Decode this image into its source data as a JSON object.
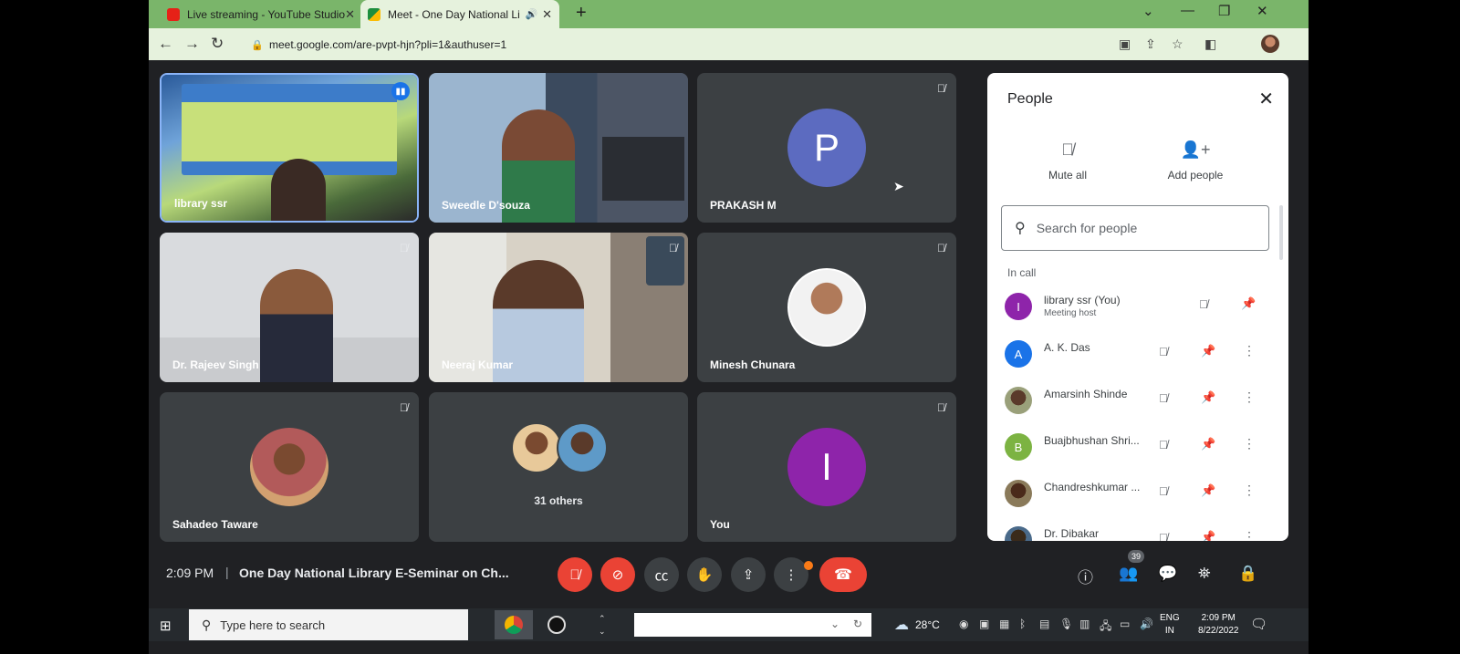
{
  "browser": {
    "tabs": [
      {
        "title": "Live streaming - YouTube Studio",
        "icon": "youtube-icon"
      },
      {
        "title": "Meet - One Day National Li",
        "icon": "meet-icon"
      }
    ],
    "url": "meet.google.com/are-pvpt-hjn?pli=1&authuser=1"
  },
  "tiles": [
    {
      "name": "library ssr",
      "kind": "video",
      "speaking": true
    },
    {
      "name": "Sweedle D'souza",
      "kind": "video"
    },
    {
      "name": "PRAKASH M",
      "kind": "letter",
      "letter": "P",
      "color": "#5c6bc0"
    },
    {
      "name": "Dr. Rajeev Singh",
      "kind": "video"
    },
    {
      "name": "Neeraj Kumar",
      "kind": "video"
    },
    {
      "name": "Minesh Chunara",
      "kind": "photo"
    },
    {
      "name": "Sahadeo Taware",
      "kind": "photo"
    },
    {
      "name": "31 others",
      "kind": "group"
    },
    {
      "name": "You",
      "kind": "letter",
      "letter": "I",
      "color": "#8e24aa"
    }
  ],
  "people_panel": {
    "title": "People",
    "mute_all": "Mute all",
    "add_people": "Add people",
    "search_placeholder": "Search for people",
    "section": "In call",
    "people": [
      {
        "name": "library ssr (You)",
        "role": "Meeting host",
        "avatar": "I",
        "color": "#8e24aa"
      },
      {
        "name": "A. K. Das",
        "avatar": "A",
        "color": "#1a73e8"
      },
      {
        "name": "Amarsinh Shinde",
        "avatar": "",
        "color": "#7a8a5a"
      },
      {
        "name": "Buajbhushan Shri...",
        "avatar": "B",
        "color": "#7cb342"
      },
      {
        "name": "Chandreshkumar ...",
        "avatar": "",
        "color": "#6d5a4a"
      },
      {
        "name": "Dr. Dibakar",
        "avatar": "",
        "color": "#4a6a8a"
      }
    ]
  },
  "meeting_bar": {
    "time": "2:09 PM",
    "separator": "|",
    "title": "One Day National Library E-Seminar on Ch...",
    "people_count": "39"
  },
  "taskbar": {
    "search_placeholder": "Type here to search",
    "temperature": "28°C",
    "lang_line1": "ENG",
    "lang_line2": "IN",
    "time": "2:09 PM",
    "date": "8/22/2022"
  }
}
